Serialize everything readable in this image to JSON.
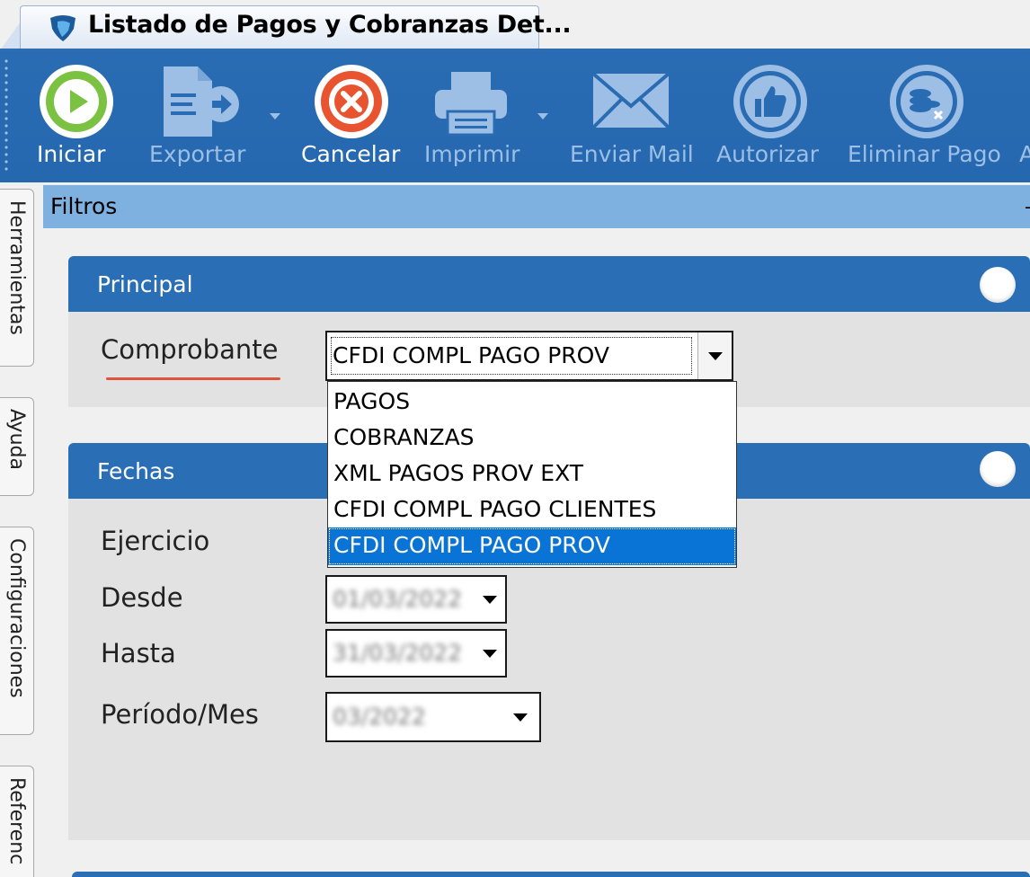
{
  "window": {
    "tab_title": "Listado de Pagos y Cobranzas Det...",
    "tab_icon": "app-logo-icon"
  },
  "toolbar": {
    "buttons": [
      {
        "label": "Iniciar",
        "icon": "play-icon",
        "enabled": true
      },
      {
        "label": "Exportar",
        "icon": "export-icon",
        "enabled": false
      },
      {
        "label": "Cancelar",
        "icon": "cancel-icon",
        "enabled": true
      },
      {
        "label": "Imprimir",
        "icon": "printer-icon",
        "enabled": false
      },
      {
        "label": "Enviar Mail",
        "icon": "mail-icon",
        "enabled": false
      },
      {
        "label": "Autorizar",
        "icon": "thumbs-up-icon",
        "enabled": false
      },
      {
        "label": "Eliminar Pago",
        "icon": "delete-payment-icon",
        "enabled": false
      }
    ]
  },
  "side_tabs": [
    "Herramientas",
    "Ayuda",
    "Configuraciones",
    "Referenc"
  ],
  "filtros": {
    "title": "Filtros"
  },
  "principal": {
    "title": "Principal",
    "comprobante_label": "Comprobante",
    "comprobante_value": "CFDI COMPL PAGO PROV",
    "options": [
      "PAGOS",
      "COBRANZAS",
      "XML PAGOS PROV EXT",
      "CFDI COMPL PAGO CLIENTES",
      "CFDI COMPL PAGO PROV"
    ],
    "selected_index": 4
  },
  "fechas": {
    "title": "Fechas",
    "ejercicio_label": "Ejercicio",
    "desde_label": "Desde",
    "desde_value": "01/03/2022",
    "hasta_label": "Hasta",
    "hasta_value": "31/03/2022",
    "periodo_label": "Período/Mes",
    "periodo_value": "03/2022"
  },
  "colors": {
    "toolbar_blue": "#2a6cb3",
    "panel_header": "#2a6fb5",
    "filtros_bar": "#7eb1df",
    "selection": "#0a74d6",
    "underline_accent": "#e0543a"
  }
}
